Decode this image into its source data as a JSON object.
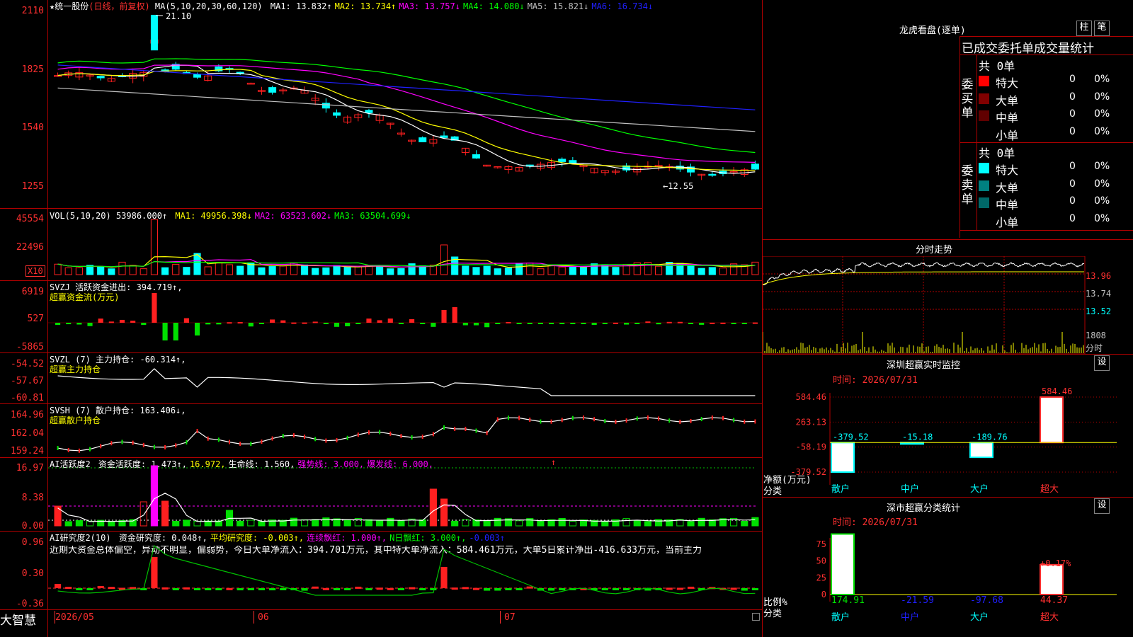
{
  "main": {
    "star_title": "★统一股份",
    "period": "(日线，前复权)",
    "ma_params": "MA(5,10,20,30,60,120)",
    "ma": [
      {
        "label": "MA1:",
        "value": "13.832↑",
        "color": "#ffffff"
      },
      {
        "label": "MA2:",
        "value": "13.734↑",
        "color": "#ffff00"
      },
      {
        "label": "MA3:",
        "value": "13.757↓",
        "color": "#ff00ff"
      },
      {
        "label": "MA4:",
        "value": "14.080↓",
        "color": "#00ff00"
      },
      {
        "label": "MA5:",
        "value": "15.821↓",
        "color": "#c0c0c0"
      },
      {
        "label": "MA6:",
        "value": "16.734↓",
        "color": "#2020ff"
      }
    ],
    "y_ticks": [
      "2110",
      "1825",
      "1540",
      "1255"
    ],
    "high_marker": "21.10",
    "low_marker": "←12.55"
  },
  "vol": {
    "title": "VOL(5,10,20)",
    "value": "53986.000↑",
    "ma": [
      {
        "label": "MA1:",
        "value": "49956.398↓",
        "color": "#ffff00"
      },
      {
        "label": "MA2:",
        "value": "63523.602↓",
        "color": "#ff00ff"
      },
      {
        "label": "MA3:",
        "value": "63504.699↓",
        "color": "#00ff00"
      }
    ],
    "y_ticks": [
      "45554",
      "22496"
    ],
    "unit": "X10"
  },
  "svzj": {
    "line1": "SVZJ  活跃资金进出: 394.719↑,",
    "line2": "超赢资金流(万元)",
    "y_ticks": [
      "6919",
      "527",
      "-5865"
    ]
  },
  "svzl": {
    "line1": "SVZL  (7) 主力持仓: -60.314↑,",
    "line2": "超赢主力持仓",
    "y_ticks": [
      "-54.52",
      "-57.67",
      "-60.81"
    ]
  },
  "svsh": {
    "line1": "SVSH  (7) 散户持仓: 163.406↓,",
    "line2": "超赢散户持仓",
    "y_ticks": [
      "164.96",
      "162.04",
      "159.24"
    ]
  },
  "ai_active": {
    "title": "AI活跃度2",
    "items": [
      {
        "text": "资金活跃度: 1.473↑,",
        "color": "#ffffff"
      },
      {
        "text": "16.972,",
        "color": "#ffff00"
      },
      {
        "text": "生命线: 1.560,",
        "color": "#ffffff"
      },
      {
        "text": "强势线: 3.000,",
        "color": "#ff00ff"
      },
      {
        "text": "爆发线: 6.000,",
        "color": "#ff00ff"
      }
    ],
    "y_ticks": [
      "16.97",
      "8.38",
      "0.00"
    ]
  },
  "ai_research": {
    "title": "AI研究度2(10)",
    "items": [
      {
        "text": "资金研究度: 0.048↑,",
        "color": "#ffffff"
      },
      {
        "text": "平均研究度: -0.003↑,",
        "color": "#ffff00"
      },
      {
        "text": "连续飘红: 1.000↑,",
        "color": "#ff00ff"
      },
      {
        "text": "N日飘红: 3.000↑,",
        "color": "#00ff00"
      },
      {
        "text": "-0.003↑",
        "color": "#2020ff"
      }
    ],
    "summary": "近期大资金总体偏空，异动不明显，偏弱势，今日大单净流入：394.701万元，其中特大单净流入：584.461万元，大单5日累计净出-416.633万元，当前主力",
    "y_ticks": [
      "0.96",
      "0.30",
      "-0.36"
    ]
  },
  "footer": {
    "brand": "大智慧",
    "dates": [
      "2026/05",
      "06",
      "07"
    ]
  },
  "right": {
    "title": "龙虎看盘(逐单)",
    "btn_zhu": "柱",
    "btn_bi": "笔",
    "header": "已成交委托单成交量统计",
    "buy": {
      "side": "委买单",
      "total": "共 0单",
      "rows": [
        {
          "name": "特大",
          "count": "0",
          "pct": "0%",
          "color": "#ff0000"
        },
        {
          "name": "大单",
          "count": "0",
          "pct": "0%",
          "color": "#800000"
        },
        {
          "name": "中单",
          "count": "0",
          "pct": "0%",
          "color": "#600000"
        },
        {
          "name": "小单",
          "count": "0",
          "pct": "0%",
          "color": "#000000"
        }
      ]
    },
    "sell": {
      "side": "委卖单",
      "total": "共 0单",
      "rows": [
        {
          "name": "特大",
          "count": "0",
          "pct": "0%",
          "color": "#00ffff"
        },
        {
          "name": "大单",
          "count": "0",
          "pct": "0%",
          "color": "#008080"
        },
        {
          "name": "中单",
          "count": "0",
          "pct": "0%",
          "color": "#006868"
        },
        {
          "name": "小单",
          "count": "0",
          "pct": "0%",
          "color": "#000000"
        }
      ]
    },
    "intraday": {
      "title": "分时走势",
      "y_ticks": [
        "13.96",
        "13.74",
        "13.52"
      ],
      "vol_tick": "1808",
      "unit": "分时"
    },
    "monitor": {
      "title": "深圳超赢实时监控",
      "btn": "设",
      "time": "时间: 2026/07/31",
      "y_ticks": [
        "584.46",
        "263.13",
        "-58.19",
        "-379.52"
      ],
      "label_net": "净额(万元)",
      "label_cat": "分类",
      "categories": [
        "散户",
        "中户",
        "大户",
        "超大"
      ],
      "values": [
        "-379.52",
        "-15.18",
        "-189.76",
        "584.46"
      ]
    },
    "classify": {
      "title": "深市超赢分类统计",
      "btn": "设",
      "time": "时间: 2026/07/31",
      "y_ticks": [
        "75",
        "50",
        "25",
        "0"
      ],
      "label_ratio": "比例%",
      "label_cat": "分类",
      "categories": [
        "散户",
        "中户",
        "大户",
        "超大"
      ],
      "values": [
        "174.91",
        "-21.59",
        "-97.68",
        "44.37"
      ],
      "pct_label": "+0.17%"
    }
  },
  "colors": {
    "up": "#ff2020",
    "down": "#00ffff",
    "grid": "#b00000"
  }
}
